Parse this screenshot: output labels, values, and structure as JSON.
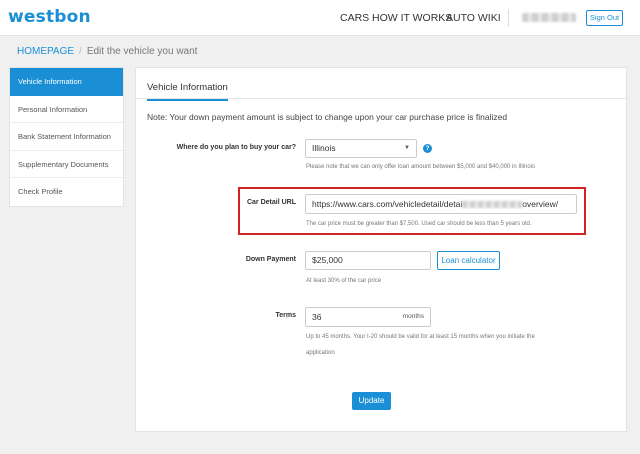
{
  "header": {
    "logo": "westbon",
    "nav": {
      "cars": "CARS",
      "how": "HOW IT WORKS",
      "wiki": "AUTO WIKI"
    },
    "signout": "Sign Out"
  },
  "breadcrumb": {
    "home": "HOMEPAGE",
    "sep": "/",
    "current": "Edit the vehicle you want"
  },
  "sidebar": {
    "items": [
      {
        "label": "Vehicle Information"
      },
      {
        "label": "Personal Information"
      },
      {
        "label": "Bank Statement Information"
      },
      {
        "label": "Supplementary Documents"
      },
      {
        "label": "Check Profile"
      }
    ]
  },
  "main": {
    "tab": "Vehicle Information",
    "note": "Note: Your down payment amount is subject to change upon your car purchase price is finalized",
    "state": {
      "label": "Where do you plan to buy your car?",
      "value": "Illinois",
      "help": "Please note that we can only offer loan amount between $5,000 and $40,000 in Illinois"
    },
    "url": {
      "label": "Car Detail URL",
      "value_prefix": "https://www.cars.com/vehicledetail/detai",
      "value_suffix": "overview/",
      "help_prefix": "The car price must be greater than $7,500. Used car",
      "help_suffix": "should be less than 5 years old."
    },
    "down": {
      "label": "Down Payment",
      "value": "$25,000",
      "button": "Loan calculator",
      "help": "At least 30% of the car price"
    },
    "terms": {
      "label": "Terms",
      "value": "36",
      "unit": "months",
      "help_line1": "Up to 45 months. Your I-20 should be valid for at least 15 months when you initiate the",
      "help_line2": "application"
    },
    "update": "Update"
  },
  "colors": {
    "accent": "#1a8fd6",
    "highlight": "#d32424"
  },
  "icons": {
    "state_help": "question-circle-icon",
    "select": "caret-down-icon"
  }
}
